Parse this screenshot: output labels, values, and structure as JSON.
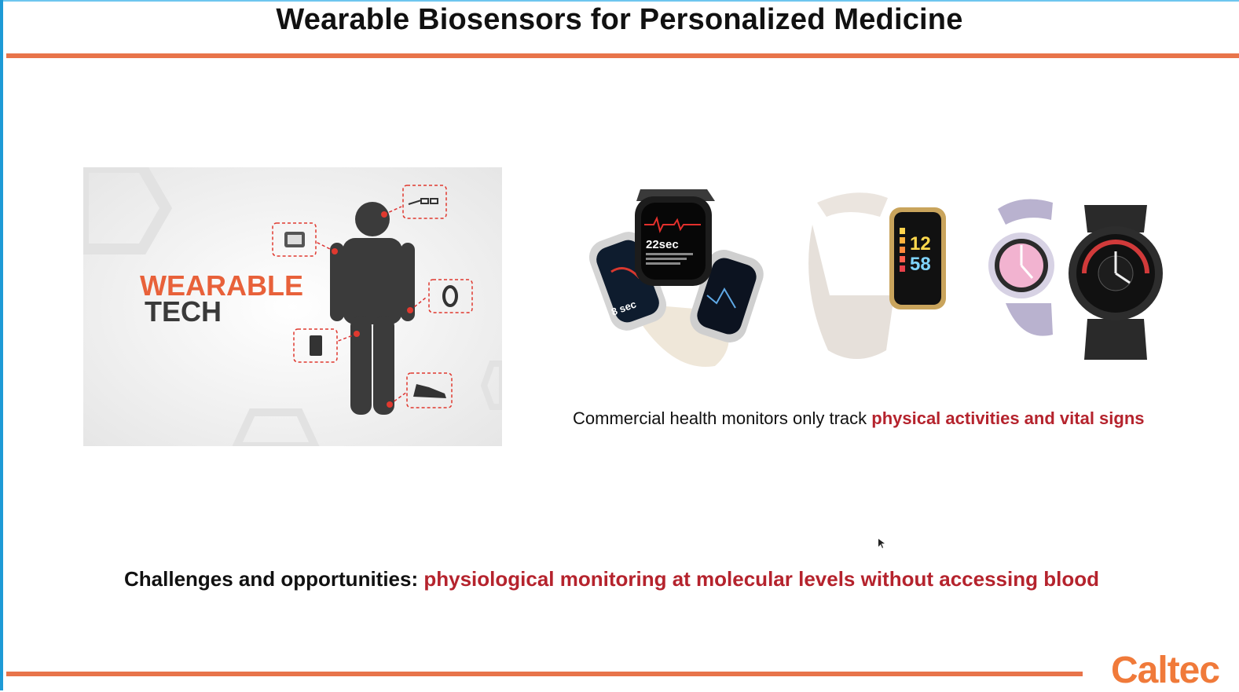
{
  "slide": {
    "title": "Wearable Biosensors for Personalized Medicine",
    "logo_text": "Caltec"
  },
  "wearable_panel": {
    "line1": "WEARABLE",
    "line2": "TECH",
    "device_icons": [
      "glasses-icon",
      "watch-icon",
      "band-icon",
      "phone-icon",
      "shoe-icon"
    ]
  },
  "watches": {
    "apple_screen_time": "22sec",
    "apple_side_time": "8 sec",
    "fitbit_top": "12",
    "fitbit_bottom": "58"
  },
  "caption": {
    "prefix": "Commercial health monitors only track ",
    "highlight": "physical activities and vital signs"
  },
  "challenge": {
    "prefix": "Challenges and opportunities: ",
    "highlight": "physiological monitoring at molecular levels without accessing blood"
  },
  "colors": {
    "accent_orange": "#e8744a",
    "highlight_red": "#b5232d",
    "logo_orange": "#f07a3a"
  }
}
